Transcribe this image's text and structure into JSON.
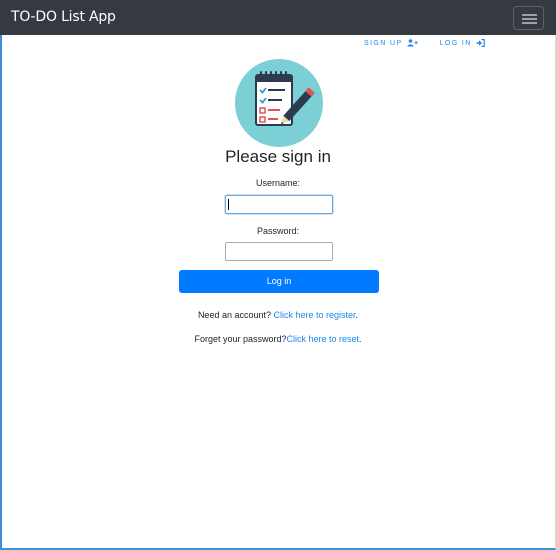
{
  "navbar": {
    "brand": "TO-DO List App",
    "toggler_icon": "hamburger-icon"
  },
  "top_links": {
    "signup_label": "SIGN UP",
    "signup_icon": "user-plus-icon",
    "login_label": "LOG IN",
    "login_icon": "sign-in-icon"
  },
  "logo_icon": "checklist-notepad-icon",
  "form": {
    "title": "Please sign in",
    "username_label": "Username:",
    "username_value": "",
    "password_label": "Password:",
    "password_value": "",
    "submit_label": "Log in"
  },
  "footer_links": {
    "register_prefix": "Need an account? ",
    "register_link": "Click here to register",
    "register_suffix": ".",
    "reset_prefix": "Forget your password?",
    "reset_link": "Click here to reset",
    "reset_suffix": "."
  },
  "colors": {
    "navbar_bg": "#343a40",
    "primary": "#007bff",
    "link": "#1e87f0",
    "logo_circle": "#7dcfd6"
  }
}
